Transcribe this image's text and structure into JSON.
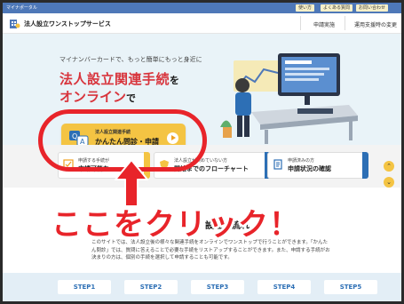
{
  "utility_bar": {
    "logo_text": "マイナポータル",
    "links": [
      "使い方",
      "よくある質問",
      "お問い合わせ"
    ]
  },
  "header": {
    "site_title": "法人設立ワンストップサービス",
    "nav": [
      "申請実施",
      "運用支援時の変更"
    ]
  },
  "hero": {
    "subtitle": "マイナンバーカードで、もっと簡単にもっと身近に",
    "title_line1": "法人設立関連手続",
    "title_line1_suffix": "を",
    "title_line2": "オンライン",
    "title_line2_suffix": "で",
    "cta": {
      "small_label": "法人設立関連手続",
      "main_label": "かんたん問診・申請",
      "icon": "qa-icon"
    }
  },
  "cards": [
    {
      "small": "申請する手続が",
      "main": "申請可能な",
      "icon": "checklist-icon"
    },
    {
      "small": "法人設立が決めていない方",
      "main": "開始までのフローチャート",
      "icon": "shield-icon"
    },
    {
      "small": "申請済みの方",
      "main": "申請状況の確認",
      "icon": "document-icon"
    }
  ],
  "annotation": {
    "text": "ここをクリック！"
  },
  "flow": {
    "heading_partial": "設立の流れ"
  },
  "description": "このサイトでは、法人設立後の様々な関連手続をオンラインでワンストップで行うことができます。「かんたん問診」では、質問に答えることで必要な手続をリストアップすることができます。また、申請する手続がお決まりの方は、個別の手続を選択して申請することも可能です。",
  "steps": [
    "STEP1",
    "STEP2",
    "STEP3",
    "STEP4",
    "STEP5"
  ],
  "colors": {
    "accent_yellow": "#f4c443",
    "annotation_red": "#e8242a",
    "hero_bg": "#e9f3f8",
    "card_tab_blue": "#2d6fb5"
  }
}
